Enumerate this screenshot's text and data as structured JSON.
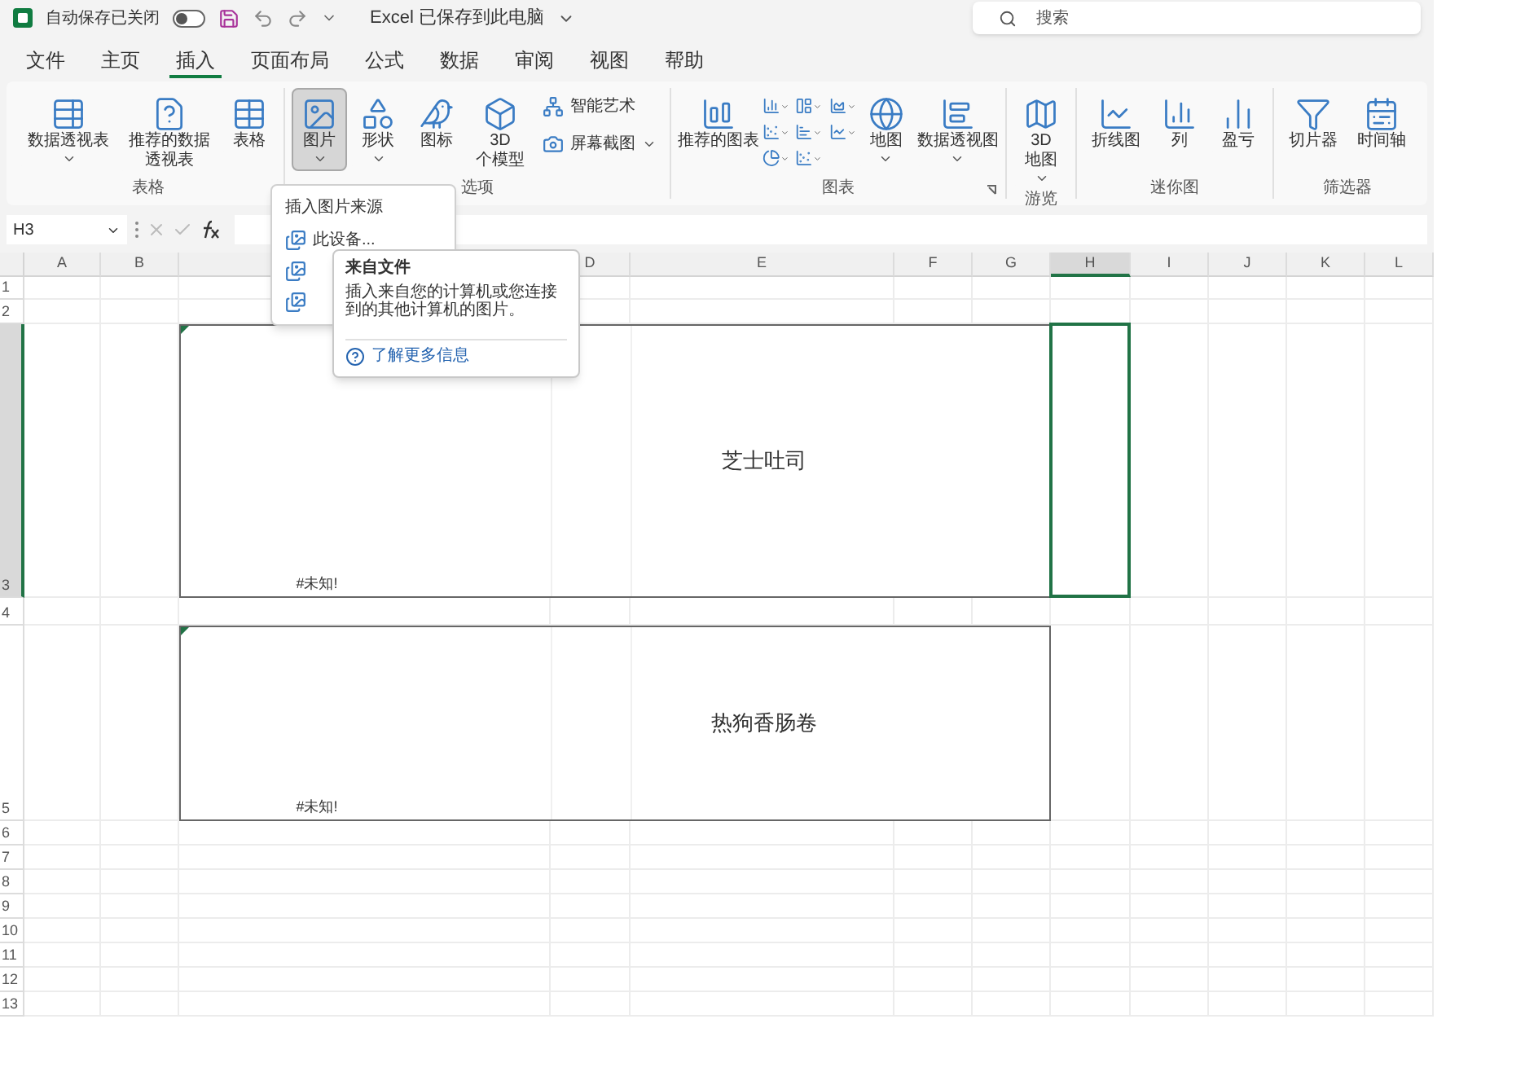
{
  "title_bar": {
    "autosave_label": "自动保存已关闭",
    "autosave_on": false,
    "file_status": "Excel 已保存到此电脑",
    "search_placeholder": "搜索"
  },
  "tabs": [
    {
      "label": "文件",
      "selected": false
    },
    {
      "label": "主页",
      "selected": false
    },
    {
      "label": "插入",
      "selected": true
    },
    {
      "label": "页面布局",
      "selected": false
    },
    {
      "label": "公式",
      "selected": false
    },
    {
      "label": "数据",
      "selected": false
    },
    {
      "label": "审阅",
      "selected": false
    },
    {
      "label": "视图",
      "selected": false
    },
    {
      "label": "帮助",
      "selected": false
    }
  ],
  "ribbon_groups": [
    {
      "label": "表格",
      "buttons": [
        {
          "kind": "large",
          "lines": [
            "数据透视表"
          ],
          "dropdown": true,
          "pressed": false
        },
        {
          "kind": "large",
          "lines": [
            "推荐的数据",
            "透视表"
          ],
          "pressed": false
        },
        {
          "kind": "large",
          "lines": [
            "表格"
          ],
          "pressed": false
        }
      ]
    },
    {
      "label": "选项",
      "buttons": [
        {
          "kind": "large",
          "lines": [
            "图片"
          ],
          "dropdown": true,
          "pressed": true
        },
        {
          "kind": "large",
          "lines": [
            "形状"
          ],
          "dropdown": true,
          "pressed": false
        },
        {
          "kind": "large",
          "lines": [
            "图标"
          ],
          "pressed": false
        },
        {
          "kind": "large",
          "lines": [
            "3D",
            "个模型"
          ],
          "pressed": false
        },
        {
          "kind": "small",
          "lines": [
            "智能艺术"
          ]
        },
        {
          "kind": "small",
          "lines": [
            "屏幕截图"
          ],
          "dropdown": true
        }
      ]
    },
    {
      "label": "图表",
      "launcher": true,
      "buttons": [
        {
          "kind": "large",
          "lines": [
            "推荐的图表"
          ],
          "pressed": false
        },
        {
          "kind": "chart_grid"
        },
        {
          "kind": "large",
          "lines": [
            "地图"
          ],
          "dropdown": true,
          "pressed": false
        },
        {
          "kind": "large",
          "lines": [
            "数据透视图"
          ],
          "dropdown": true,
          "pressed": false
        }
      ]
    },
    {
      "label": "游览",
      "buttons": [
        {
          "kind": "large",
          "lines": [
            "3D",
            "地图"
          ],
          "dropdown": true,
          "pressed": false
        }
      ]
    },
    {
      "label": "迷你图",
      "buttons": [
        {
          "kind": "large",
          "lines": [
            "折线图"
          ],
          "pressed": false
        },
        {
          "kind": "large",
          "lines": [
            "列"
          ],
          "pressed": false
        },
        {
          "kind": "large",
          "lines": [
            "盈亏"
          ],
          "pressed": false
        }
      ]
    },
    {
      "label": "筛选器",
      "buttons": [
        {
          "kind": "large",
          "lines": [
            "切片器"
          ],
          "pressed": false
        },
        {
          "kind": "large",
          "lines": [
            "时间轴"
          ],
          "pressed": false
        }
      ]
    }
  ],
  "name_box": "H3",
  "columns": [
    {
      "label": "A",
      "selected": false
    },
    {
      "label": "B",
      "selected": false
    },
    {
      "selected": false
    },
    {
      "label": "D",
      "selected": false
    },
    {
      "label": "E",
      "selected": false
    },
    {
      "label": "F",
      "selected": false
    },
    {
      "label": "G",
      "selected": false
    },
    {
      "label": "H",
      "selected": true
    },
    {
      "label": "I",
      "selected": false
    },
    {
      "label": "J",
      "selected": false
    },
    {
      "label": "K",
      "selected": false
    },
    {
      "label": "L",
      "selected": false
    }
  ],
  "rows": [
    {
      "label": "1",
      "selected": false
    },
    {
      "label": "2",
      "selected": false
    },
    {
      "label": "3",
      "selected": true
    },
    {
      "label": "4",
      "selected": false
    },
    {
      "label": "5",
      "selected": false
    },
    {
      "label": "6",
      "selected": false
    },
    {
      "label": "7",
      "selected": false
    },
    {
      "label": "8",
      "selected": false
    },
    {
      "label": "9",
      "selected": false
    },
    {
      "label": "10",
      "selected": false
    },
    {
      "label": "11",
      "selected": false
    },
    {
      "label": "12",
      "selected": false
    },
    {
      "label": "13",
      "selected": false
    }
  ],
  "merged_cells": [
    {
      "error": "#未知!",
      "text": "芝士吐司",
      "flagged": true
    },
    {
      "error": "#未知!",
      "text": "热狗香肠卷",
      "flagged": true
    }
  ],
  "picture_menu": {
    "header": "插入图片来源",
    "items": [
      {
        "kind": "text",
        "label": "此设备..."
      },
      {
        "kind": "covered"
      },
      {
        "kind": "covered"
      }
    ]
  },
  "tooltip": {
    "title": "来自文件",
    "body": "插入来自您的计算机或您连接到的其他计算机的图片。",
    "link": "了解更多信息"
  }
}
